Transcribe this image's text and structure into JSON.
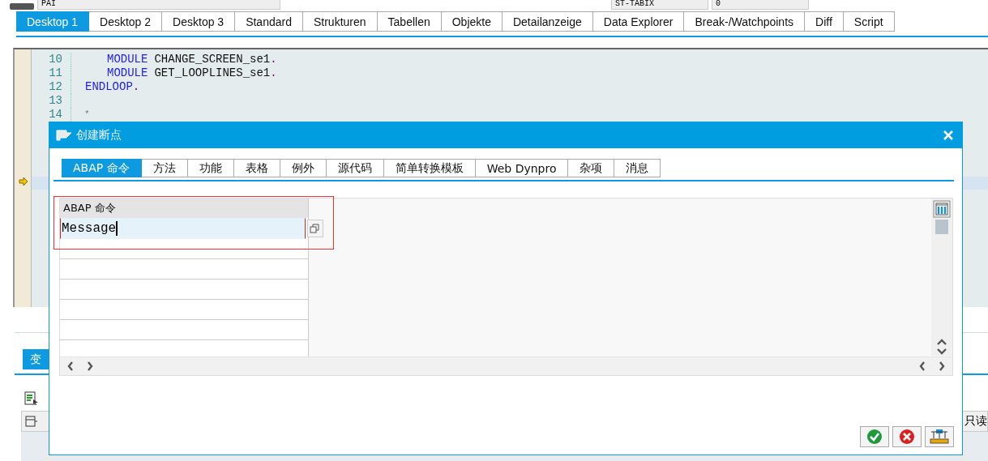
{
  "top_fields": [
    {
      "value": "PAI"
    },
    {
      "value": "ST-TABIX"
    },
    {
      "value": "0"
    }
  ],
  "main_tabs": [
    {
      "label": "Desktop 1",
      "selected": true
    },
    {
      "label": "Desktop 2",
      "selected": false
    },
    {
      "label": "Desktop 3",
      "selected": false
    },
    {
      "label": "Standard",
      "selected": false
    },
    {
      "label": "Strukturen",
      "selected": false
    },
    {
      "label": "Tabellen",
      "selected": false
    },
    {
      "label": "Objekte",
      "selected": false
    },
    {
      "label": "Detailanzeige",
      "selected": false
    },
    {
      "label": "Data Explorer",
      "selected": false
    },
    {
      "label": "Break-/Watchpoints",
      "selected": false
    },
    {
      "label": "Diff",
      "selected": false
    },
    {
      "label": "Script",
      "selected": false
    }
  ],
  "code_lines": [
    {
      "number": "10",
      "kind": "inner",
      "parts": [
        {
          "kind": "keyword",
          "text": "MODULE"
        },
        {
          "kind": "plain",
          "text": "CHANGE_SCREEN_se1"
        },
        {
          "kind": "punct",
          "text": "."
        }
      ]
    },
    {
      "number": "11",
      "kind": "inner",
      "parts": [
        {
          "kind": "keyword",
          "text": "MODULE"
        },
        {
          "kind": "plain",
          "text": "GET_LOOPLINES_se1"
        },
        {
          "kind": "punct",
          "text": "."
        }
      ]
    },
    {
      "number": "12",
      "kind": "outer",
      "parts": [
        {
          "kind": "keyword",
          "text": "ENDLOOP"
        },
        {
          "kind": "punct",
          "text": "."
        }
      ]
    },
    {
      "number": "13",
      "kind": "outer"
    },
    {
      "number": "14",
      "kind": "comment",
      "parts": [
        {
          "kind": "comment",
          "text": "*"
        }
      ]
    }
  ],
  "lower_panel": {
    "tab": "变",
    "column_label": "只读"
  },
  "dialog": {
    "title": "创建断点",
    "tabs": [
      {
        "label": "ABAP 命令",
        "selected": true
      },
      {
        "label": "方法",
        "selected": false
      },
      {
        "label": "功能",
        "selected": false
      },
      {
        "label": "表格",
        "selected": false
      },
      {
        "label": "例外",
        "selected": false
      },
      {
        "label": "源代码",
        "selected": false
      },
      {
        "label": "简单转换模板",
        "selected": false
      },
      {
        "label": "Web Dynpro",
        "selected": false
      },
      {
        "label": "杂项",
        "selected": false
      },
      {
        "label": "消息",
        "selected": false
      }
    ],
    "table": {
      "column": "ABAP 命令",
      "value": "Message"
    }
  }
}
